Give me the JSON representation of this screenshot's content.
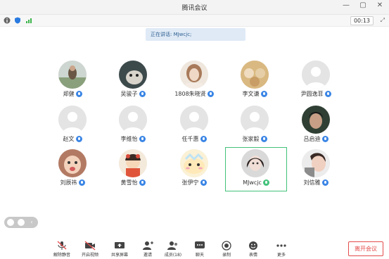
{
  "window": {
    "title": "腾讯会议"
  },
  "status": {
    "timer": "00:13",
    "speaking": "正在讲话: MJwcjc;"
  },
  "participants": [
    {
      "name": "郑健"
    },
    {
      "name": "吴骏子"
    },
    {
      "name": "1808朱晓贤"
    },
    {
      "name": "李文谦"
    },
    {
      "name": "尹圆逸菲"
    },
    {
      "name": "赵文"
    },
    {
      "name": "李维怡"
    },
    {
      "name": "任千惠"
    },
    {
      "name": "张家毅"
    },
    {
      "name": "吕启迪"
    },
    {
      "name": "刘辰祎"
    },
    {
      "name": "黄雪怡"
    },
    {
      "name": "张伊宁"
    },
    {
      "name": "MJwcjc"
    },
    {
      "name": "刘信雅"
    }
  ],
  "toolbar": {
    "unmute": "解除静音",
    "video": "开启视频",
    "share": "共享屏幕",
    "invite": "邀请",
    "members": "成员(18)",
    "chat": "聊天",
    "record": "录制",
    "reactions": "表情",
    "more": "更多",
    "leave": "离开会议"
  },
  "colors": {
    "accent": "#3a85e5",
    "leave": "#e44b4b",
    "selected": "#42c27a"
  }
}
